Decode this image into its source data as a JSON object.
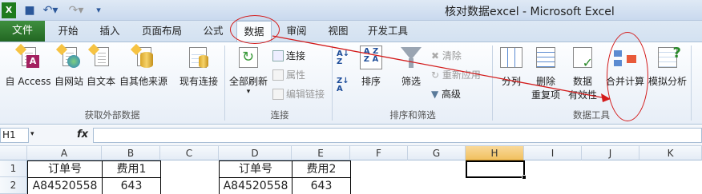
{
  "window": {
    "title": "核对数据excel - Microsoft Excel",
    "quick_access": {
      "save_icon": "save-icon",
      "undo_icon": "undo-icon",
      "redo_icon": "redo-icon",
      "customize_icon": "customize-icon"
    }
  },
  "tabs": {
    "file": "文件",
    "items": [
      "开始",
      "插入",
      "页面布局",
      "公式",
      "数据",
      "审阅",
      "视图",
      "开发工具"
    ],
    "active": "数据"
  },
  "ribbon": {
    "groups": {
      "get_external": {
        "label": "获取外部数据",
        "buttons": [
          "自 Access",
          "自网站",
          "自文本",
          "自其他来源",
          "现有连接"
        ]
      },
      "connections": {
        "label": "连接",
        "refresh_all": "全部刷新",
        "small": [
          "连接",
          "属性",
          "编辑链接"
        ]
      },
      "sort_filter": {
        "label": "排序和筛选",
        "sort": "排序",
        "filter": "筛选",
        "small": [
          "清除",
          "重新应用",
          "高级"
        ]
      },
      "data_tools": {
        "label": "数据工具",
        "text_to_columns": "分列",
        "remove_dup_1": "删除",
        "remove_dup_2": "重复项",
        "validation_1": "数据",
        "validation_2": "有效性",
        "consolidate": "合并计算",
        "what_if": "模拟分析"
      }
    }
  },
  "formula_bar": {
    "name_box": "H1",
    "fx": "fx",
    "value": ""
  },
  "sheet": {
    "columns": [
      "A",
      "B",
      "C",
      "D",
      "E",
      "F",
      "G",
      "H",
      "I",
      "J",
      "K"
    ],
    "selected_column": "H",
    "rows": [
      "1",
      "2"
    ],
    "cells": {
      "A1": "订单号",
      "B1": "费用1",
      "D1": "订单号",
      "E1": "费用2",
      "A2": "A84520558",
      "B2": "643",
      "D2": "A84520558",
      "E2": "643"
    }
  },
  "colors": {
    "file_tab": "#2a7a2a",
    "annotation": "#d31b1b",
    "selected_header": "#f1c15f"
  }
}
